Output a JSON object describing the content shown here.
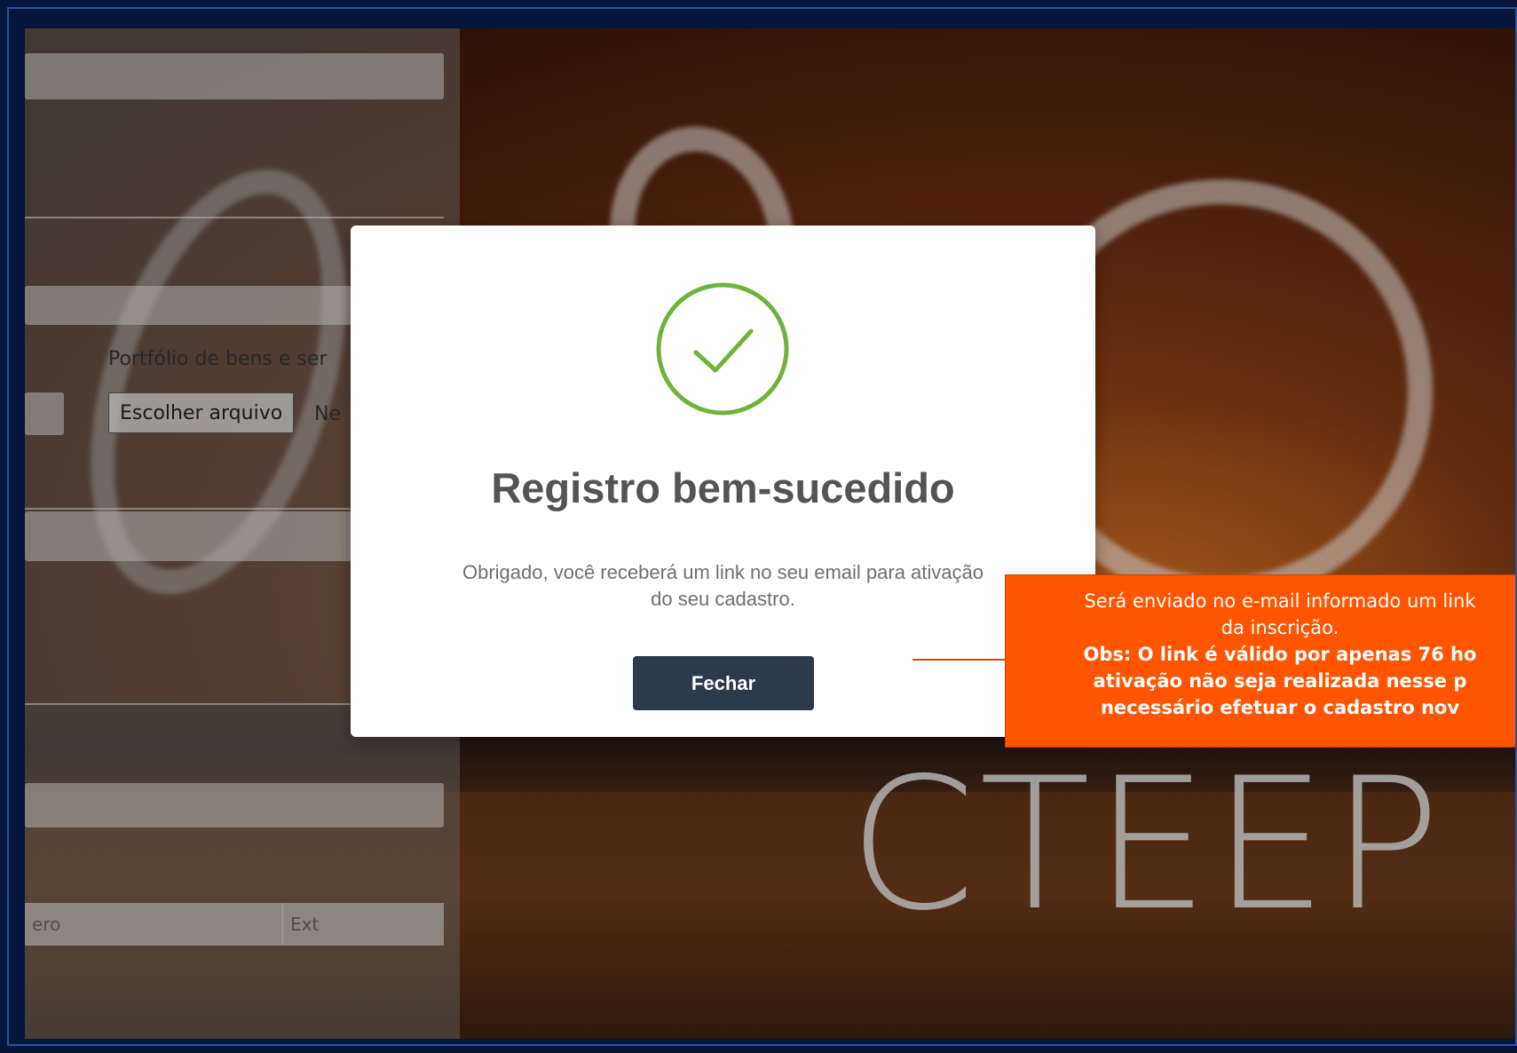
{
  "form": {
    "portfolio_label": "Portfólio de bens e ser",
    "file_button": "Escolher arquivo",
    "file_status": "Ne",
    "phone_number_placeholder": "ero",
    "phone_ext_placeholder": "Ext"
  },
  "background": {
    "brand_text": "CTEEP"
  },
  "modal": {
    "icon": "check-circle-icon",
    "title": "Registro bem-sucedido",
    "message_line1": "Obrigado, você receberá um link no seu email para ativação",
    "message_line2": "do seu cadastro.",
    "close_button": "Fechar",
    "icon_color": "#6fb33c"
  },
  "callout": {
    "line1": "Será enviado no e-mail informado um link",
    "line2": "da inscrição.",
    "bold_line1": "Obs: O link é válido por apenas 76 ho",
    "bold_line2": "ativação não seja realizada nesse p",
    "bold_line3": "necessário efetuar o cadastro nov",
    "color": "#ff5500"
  }
}
